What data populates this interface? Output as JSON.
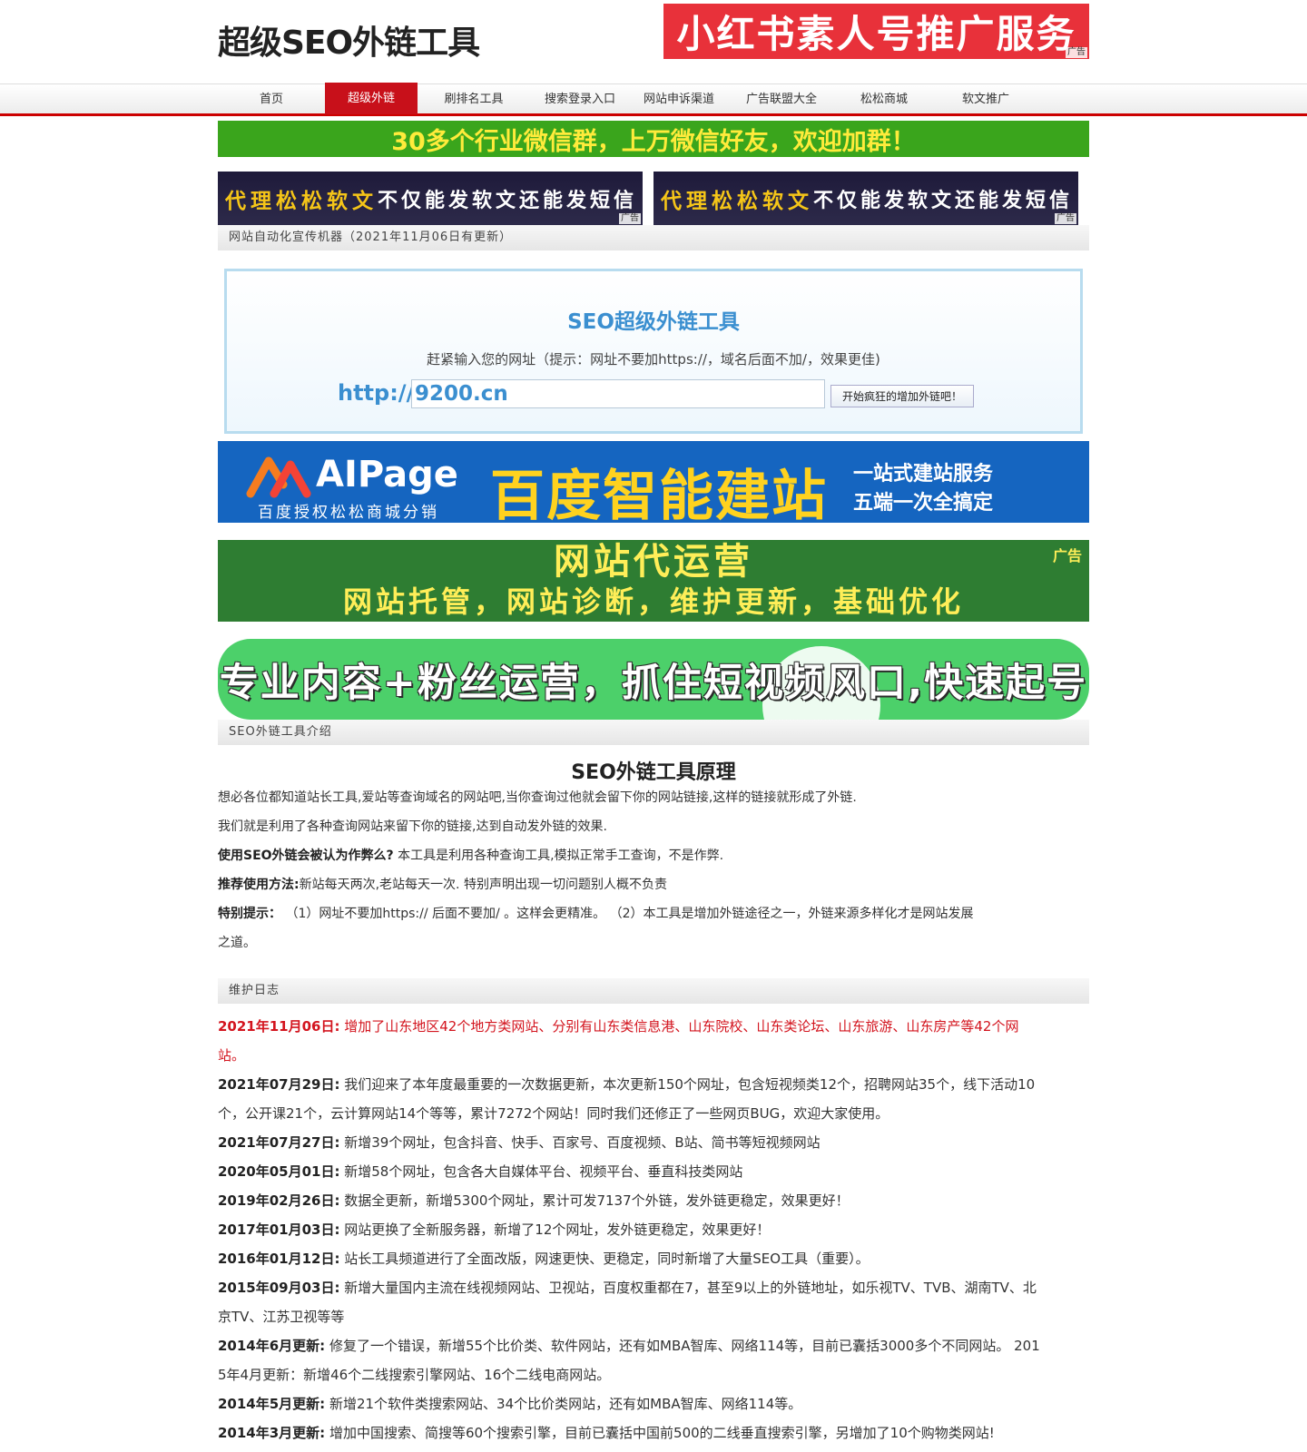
{
  "header": {
    "logo": "超级SEO外链工具",
    "top_ad_text": "小红书素人号推广服务",
    "ad_tag": "广告"
  },
  "nav": {
    "items": [
      "首页",
      "超级外链",
      "刷排名工具",
      "搜索登录入口",
      "网站申诉渠道",
      "广告联盟大全",
      "松松商城",
      "软文推广"
    ],
    "active_index": 1
  },
  "ads": {
    "green_banner": "30多个行业微信群，上万微信好友，欢迎加群！",
    "small_yellow": "代理松松软文",
    "small_white": "不仅能发软文还能发短信",
    "ai_brand": "AIPage",
    "ai_sub": "百度授权松松商城分销",
    "ai_main": "百度智能建站",
    "ai_side1": "一站式建站服务",
    "ai_side2": "五端一次全搞定",
    "dkgreen_1": "网站代运营",
    "dkgreen_2": "网站托管，网站诊断，维护更新，基础优化",
    "dkgreen_tag": "广告",
    "pill_text": "专业内容+粉丝运营，抓住短视频风口,快速起号"
  },
  "section1": {
    "label": "网站自动化宣传机器（2021年11月06日有更新）"
  },
  "tool": {
    "title": "SEO超级外链工具",
    "hint": "赶紧输入您的网址（提示：网址不要加https://，域名后面不加/，效果更佳)",
    "prefix": "http://",
    "input_value": "9200.cn",
    "button": "开始疯狂的增加外链吧！"
  },
  "section2": {
    "label": "SEO外链工具介绍"
  },
  "intro": {
    "title": "SEO外链工具原理",
    "p1": "想必各位都知道站长工具,爱站等查询域名的网站吧,当你查询过他就会留下你的网站链接,这样的链接就形成了外链.",
    "p2": "我们就是利用了各种查询网站来留下你的链接,达到自动发外链的效果.",
    "p3_bold": "使用SEO外链会被认为作弊么?",
    "p3": " 本工具是利用各种查询工具,模拟正常手工查询，不是作弊.",
    "p4_bold": "推荐使用方法:",
    "p4": "新站每天两次,老站每天一次. 特别声明出现一切问题别人概不负责",
    "p5_bold": "特别提示：",
    "p5": "  （1）网址不要加https:// 后面不要加/ 。这样会更精准。  （2）本工具是增加外链途径之一，外链来源多样化才是网站发展",
    "p5b": "之道。"
  },
  "section3": {
    "label": "维护日志"
  },
  "log": [
    {
      "date": "2021年11月06日:",
      "text": " 增加了山东地区42个地方类网站、分别有山东类信息港、山东院校、山东类论坛、山东旅游、山东房产等42个网",
      "cont": "站。"
    },
    {
      "date": "2021年07月29日:",
      "text": " 我们迎来了本年度最重要的一次数据更新，本次更新150个网址，包含短视频类12个，招聘网站35个，线下活动10",
      "cont": "个，公开课21个，云计算网站14个等等，累计7272个网站！同时我们还修正了一些网页BUG，欢迎大家使用。"
    },
    {
      "date": "2021年07月27日:",
      "text": " 新增39个网址，包含抖音、快手、百家号、百度视频、B站、简书等短视频网站"
    },
    {
      "date": "2020年05月01日:",
      "text": " 新增58个网址，包含各大自媒体平台、视频平台、垂直科技类网站"
    },
    {
      "date": "2019年02月26日:",
      "text": " 数据全更新，新增5300个网址，累计可发7137个外链，发外链更稳定，效果更好！"
    },
    {
      "date": "2017年01月03日:",
      "text": " 网站更换了全新服务器，新增了12个网址，发外链更稳定，效果更好！"
    },
    {
      "date": "2016年01月12日:",
      "text": " 站长工具频道进行了全面改版，网速更快、更稳定，同时新增了大量SEO工具（重要）。"
    },
    {
      "date": "2015年09月03日:",
      "text": " 新增大量国内主流在线视频网站、卫视站，百度权重都在7，甚至9以上的外链地址，如乐视TV、TVB、湖南TV、北",
      "cont": "京TV、江苏卫视等等"
    },
    {
      "date": "2014年6月更新:",
      "text": " 修复了一个错误，新增55个比价类、软件网站，还有如MBA智库、网络114等，目前已囊括3000多个不同网站。 201",
      "cont": "5年4月更新：新增46个二线搜索引擎网站、16个二线电商网站。"
    },
    {
      "date": "2014年5月更新:",
      "text": " 新增21个软件类搜索网站、34个比价类网站，还有如MBA智库、网络114等。"
    },
    {
      "date": "2014年3月更新:",
      "text": " 增加中国搜索、简搜等60个搜索引擎，目前已囊括中国前500的二线垂直搜索引擎，另增加了10个购物类网站!"
    }
  ]
}
